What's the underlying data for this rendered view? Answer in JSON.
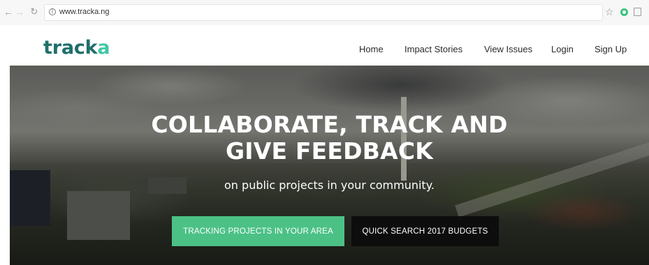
{
  "browser": {
    "url": "www.tracka.ng",
    "back_icon": "back-arrow-icon",
    "forward_icon": "forward-arrow-icon",
    "reload_icon": "reload-icon",
    "info_icon": "info-icon",
    "bookmark_icon": "star-icon",
    "extension_icons": [
      "grammarly-icon",
      "extension-square-icon"
    ]
  },
  "site": {
    "logo_part1": "track",
    "logo_part2": "a",
    "brand_colors": {
      "dark": "#1f6f6c",
      "light": "#43c6a6"
    },
    "nav": [
      {
        "label": "Home"
      },
      {
        "label": "Impact Stories"
      },
      {
        "label": "View Issues"
      },
      {
        "label": "Login"
      },
      {
        "label": "Sign Up"
      }
    ]
  },
  "hero": {
    "title_line1": "COLLABORATE, TRACK AND",
    "title_line2": "GIVE FEEDBACK",
    "subtitle": "on public projects in your community.",
    "primary_button": "TRACKING PROJECTS IN YOUR AREA",
    "secondary_button": "QUICK SEARCH 2017 BUDGETS",
    "primary_color": "#4cc186",
    "secondary_color": "#0d0d0d"
  }
}
